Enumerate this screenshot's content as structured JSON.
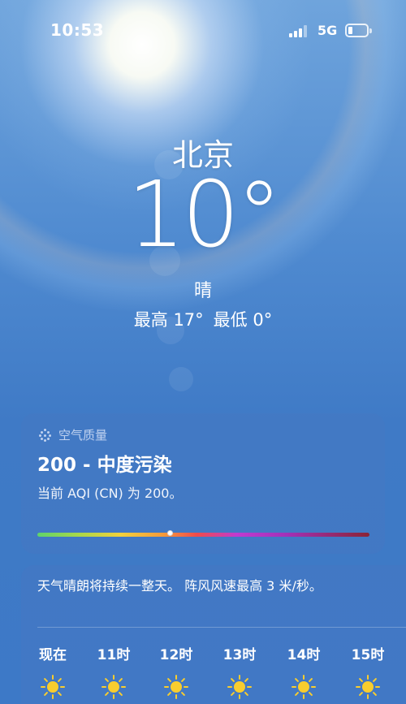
{
  "status_bar": {
    "time": "10:53",
    "network": "5G",
    "icons": [
      "cellular-signal-icon",
      "battery-icon"
    ]
  },
  "weather": {
    "city": "北京",
    "temperature": "10°",
    "condition": "晴",
    "high": "最高 17°",
    "low": "最低 0°"
  },
  "air_quality": {
    "header": "空气质量",
    "icon": "air-quality-icon",
    "title": "200 - 中度污染",
    "description": "当前 AQI (CN) 为 200。",
    "aqi_value": 200
  },
  "forecast": {
    "summary": "天气晴朗将持续一整天。 阵风风速最高 3 米/秒。",
    "hours": [
      {
        "label": "现在",
        "icon": "sun-icon"
      },
      {
        "label": "11时",
        "icon": "sun-icon"
      },
      {
        "label": "12时",
        "icon": "sun-icon"
      },
      {
        "label": "13时",
        "icon": "sun-icon"
      },
      {
        "label": "14时",
        "icon": "sun-icon"
      },
      {
        "label": "15时",
        "icon": "sun-icon"
      }
    ]
  },
  "colors": {
    "sky_top": "#6fa4dc",
    "sky_bottom": "#3d79c7",
    "sun_icon": "#f8cd2e"
  }
}
